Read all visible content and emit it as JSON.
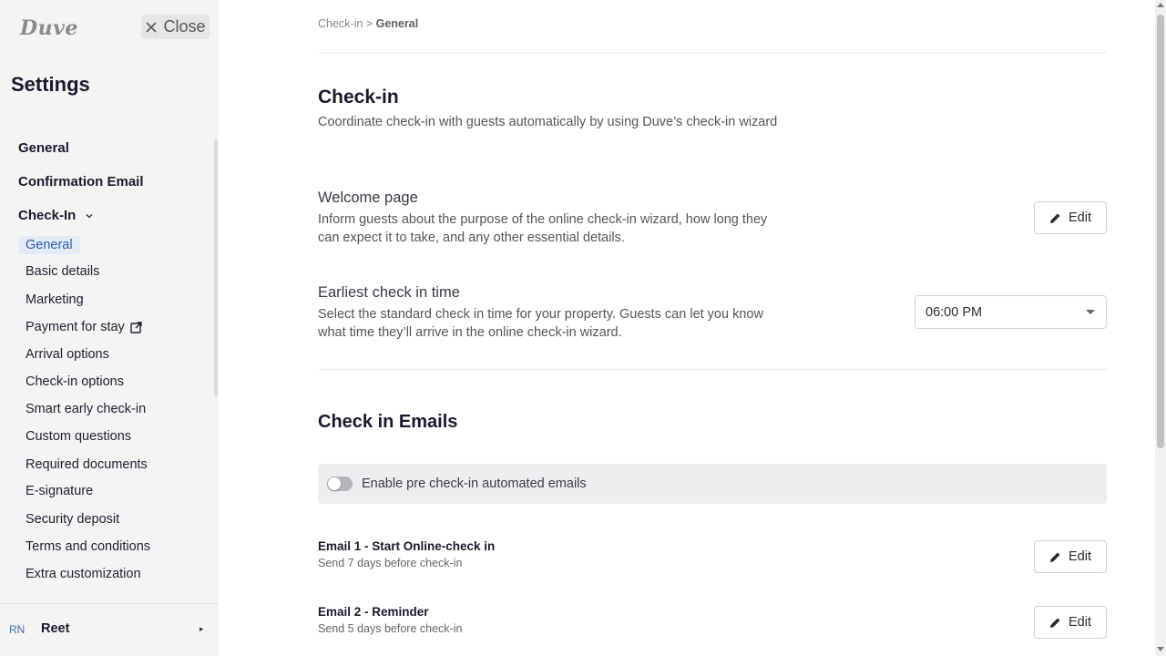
{
  "sidebar": {
    "logo": "Duve",
    "close_label": "Close",
    "title": "Settings",
    "nav": {
      "general": "General",
      "confirmation_email": "Confirmation Email",
      "check_in": "Check-In"
    },
    "sub_items": [
      "General",
      "Basic details",
      "Marketing",
      "Payment for stay",
      "Arrival options",
      "Check-in options",
      "Smart early check-in",
      "Custom questions",
      "Required documents",
      "E-signature",
      "Security deposit",
      "Terms and conditions",
      "Extra customization"
    ],
    "user": {
      "initials": "RN",
      "name": "Reet"
    }
  },
  "main": {
    "breadcrumb": {
      "parent": "Check-in",
      "separator": ">",
      "current": "General"
    },
    "title": "Check-in",
    "subtitle": "Coordinate check-in with guests automatically by using Duve’s check-in wizard",
    "welcome": {
      "title": "Welcome page",
      "desc": "Inform guests about the purpose of the online check-in wizard, how long they can expect it to take, and any other essential details.",
      "edit_label": "Edit"
    },
    "earliest": {
      "title": "Earliest check in time",
      "desc": "Select the standard check in time for your property. Guests can let you know what time they’ll arrive in the online check-in wizard.",
      "value": "06:00 PM"
    },
    "emails": {
      "title": "Check in Emails",
      "toggle_label": "Enable pre check-in automated emails",
      "toggle_on": false,
      "items": [
        {
          "title": "Email 1 - Start Online-check in",
          "sub": "Send 7 days before check-in",
          "edit_label": "Edit"
        },
        {
          "title": "Email 2 - Reminder",
          "sub": "Send 5 days before check-in",
          "edit_label": "Edit"
        }
      ]
    }
  },
  "colors": {
    "accent": "#2a5db0",
    "sidebar_bg": "#f4f4f5",
    "active_bg": "#e4ebf7"
  }
}
